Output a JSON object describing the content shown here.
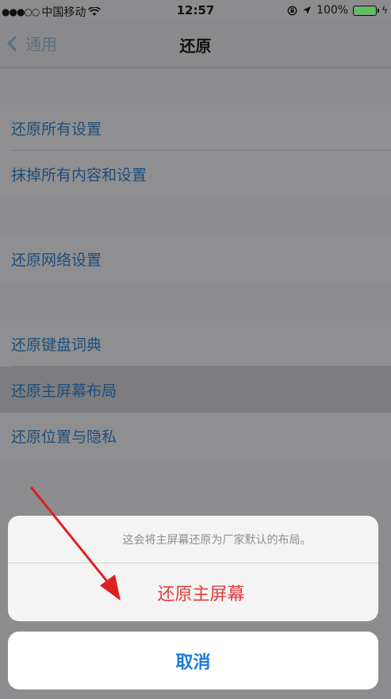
{
  "status_bar": {
    "signal": "●●●○○",
    "carrier": "中国移动",
    "wifi_icon": "wifi-icon",
    "time": "12:57",
    "lock_icon": "orientation-lock-icon",
    "location_icon": "location-arrow-icon",
    "battery_percent": "100%",
    "battery_level": 1.0,
    "charging_icon": "bolt-icon"
  },
  "nav": {
    "back_label": "通用",
    "title": "还原"
  },
  "group1": {
    "items": [
      {
        "label": "还原所有设置"
      },
      {
        "label": "抹掉所有内容和设置"
      }
    ]
  },
  "group2": {
    "items": [
      {
        "label": "还原网络设置"
      }
    ]
  },
  "group3": {
    "items": [
      {
        "label": "还原键盘词典"
      },
      {
        "label": "还原主屏幕布局"
      },
      {
        "label": "还原位置与隐私"
      }
    ]
  },
  "action_sheet": {
    "message": "这会将主屏幕还原为厂家默认的布局。",
    "destructive_label": "还原主屏幕",
    "cancel_label": "取消"
  },
  "colors": {
    "destructive": "#e23b3b",
    "cancel": "#1e7ad8",
    "annotation_arrow": "#e02020",
    "battery": "#5ac35a"
  }
}
